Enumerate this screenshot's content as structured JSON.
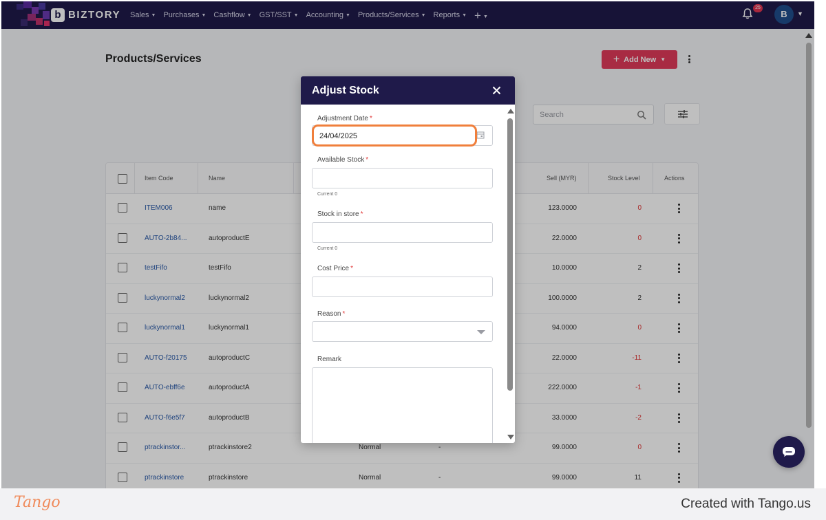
{
  "app": {
    "brand": "BIZTORY",
    "logo_mark": "b",
    "nav": [
      {
        "label": "Sales"
      },
      {
        "label": "Purchases"
      },
      {
        "label": "Cashflow"
      },
      {
        "label": "GST/SST"
      },
      {
        "label": "Accounting"
      },
      {
        "label": "Products/Services"
      },
      {
        "label": "Reports"
      }
    ],
    "nav_plus": "+",
    "notification_count": "25",
    "avatar_initial": "B"
  },
  "page": {
    "title": "Products/Services",
    "add_new_label": "Add New",
    "search_placeholder": "Search"
  },
  "table": {
    "columns": [
      "Item Code",
      "Name",
      "Sell (MYR)",
      "Stock Level",
      "Actions"
    ],
    "rows": [
      {
        "code": "ITEM006",
        "name": "name",
        "type": "",
        "extra": "",
        "sell": "123.0000",
        "stock": "0",
        "stock_negative": true
      },
      {
        "code": "AUTO-2b84...",
        "name": "autoproductE",
        "type": "",
        "extra": "",
        "sell": "22.0000",
        "stock": "0",
        "stock_negative": true
      },
      {
        "code": "testFifo",
        "name": "testFifo",
        "type": "",
        "extra": "",
        "sell": "10.0000",
        "stock": "2",
        "stock_negative": false
      },
      {
        "code": "luckynormal2",
        "name": "luckynormal2",
        "type": "",
        "extra": "",
        "sell": "100.0000",
        "stock": "2",
        "stock_negative": false
      },
      {
        "code": "luckynormal1",
        "name": "luckynormal1",
        "type": "",
        "extra": "",
        "sell": "94.0000",
        "stock": "0",
        "stock_negative": true
      },
      {
        "code": "AUTO-f20175",
        "name": "autoproductC",
        "type": "",
        "extra": "",
        "sell": "22.0000",
        "stock": "-11",
        "stock_negative": true
      },
      {
        "code": "AUTO-ebff6e",
        "name": "autoproductA",
        "type": "",
        "extra": "",
        "sell": "222.0000",
        "stock": "-1",
        "stock_negative": true
      },
      {
        "code": "AUTO-f6e5f7",
        "name": "autoproductB",
        "type": "",
        "extra": "",
        "sell": "33.0000",
        "stock": "-2",
        "stock_negative": true
      },
      {
        "code": "ptrackinstor...",
        "name": "ptrackinstore2",
        "type": "Normal",
        "extra": "-",
        "sell": "99.0000",
        "stock": "0",
        "stock_negative": true
      },
      {
        "code": "ptrackinstore",
        "name": "ptrackinstore",
        "type": "Normal",
        "extra": "-",
        "sell": "99.0000",
        "stock": "11",
        "stock_negative": false
      }
    ]
  },
  "modal": {
    "title": "Adjust Stock",
    "fields": {
      "adjustment_date": {
        "label": "Adjustment Date",
        "value": "24/04/2025"
      },
      "available_stock": {
        "label": "Available Stock",
        "value": "",
        "helper": "Current 0"
      },
      "stock_in_store": {
        "label": "Stock in store",
        "value": "",
        "helper": "Current 0"
      },
      "cost_price": {
        "label": "Cost Price",
        "value": ""
      },
      "reason": {
        "label": "Reason",
        "value": ""
      },
      "remark": {
        "label": "Remark",
        "value": ""
      }
    },
    "required_mark": "*"
  },
  "footer": {
    "logo": "Tango",
    "credit": "Created with Tango.us"
  },
  "colors": {
    "navbar": "#1f1a4a",
    "accent_button": "#e03a5a",
    "link": "#2a5aa8",
    "negative": "#e03535",
    "highlight": "#f07f3c"
  }
}
